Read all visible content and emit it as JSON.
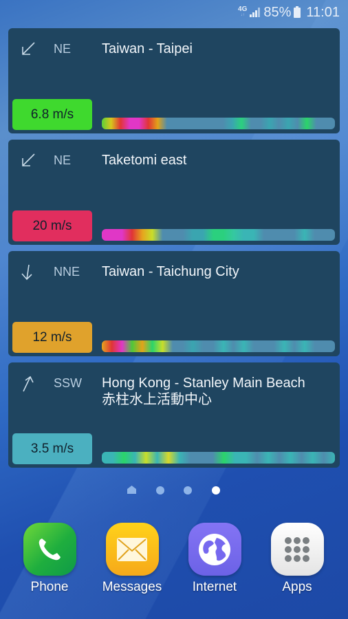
{
  "statusbar": {
    "network": "4G",
    "signal_icon": "signal-bars-icon",
    "battery_percent": "85%",
    "battery_icon": "battery-icon",
    "time": "11:01"
  },
  "widgets": [
    {
      "direction": "NE",
      "arrow_icon": "arrow-down-left-icon",
      "location": "Taiwan - Taipei",
      "subtitle": "",
      "speed": "6.8 m/s",
      "speed_color": "#3fd92e",
      "forecast_colors": [
        "#5cd03a",
        "#d6c81d",
        "#e03535",
        "#e037c6",
        "#e037c6",
        "#e03535",
        "#e3a319",
        "#4f8cae",
        "#4f8cae",
        "#4f8cae",
        "#4f8cae",
        "#4f8cae",
        "#4f8cae",
        "#4f8cae",
        "#3aa5b0",
        "#2bd07e",
        "#4f8cae",
        "#4f8cae",
        "#3aa5b0",
        "#4f8cae",
        "#3aa5b0",
        "#4f8cae",
        "#2bd46a",
        "#4f8cae",
        "#4f8cae",
        "#4f8cae"
      ]
    },
    {
      "direction": "NE",
      "arrow_icon": "arrow-down-left-icon",
      "location": "Taketomi east",
      "subtitle": "",
      "speed": "20 m/s",
      "speed_color": "#e12e5e",
      "forecast_colors": [
        "#e037c6",
        "#e037c6",
        "#e037c6",
        "#e03535",
        "#e6a41e",
        "#c8de2a",
        "#4f8cae",
        "#4f8cae",
        "#4f8cae",
        "#3aa5b0",
        "#3aa5b0",
        "#2bd07e",
        "#2bd07e",
        "#35c8a0",
        "#3ab5b5",
        "#3ab5b5",
        "#4f8cae",
        "#4f8cae",
        "#4f8cae",
        "#4f8cae",
        "#3ab5b5",
        "#4f8cae",
        "#4f8cae",
        "#4f8cae"
      ]
    },
    {
      "direction": "NNE",
      "arrow_icon": "arrow-down-icon",
      "location": "Taiwan - Taichung City",
      "subtitle": "",
      "speed": "12 m/s",
      "speed_color": "#e0a22c",
      "forecast_colors": [
        "#e6a41e",
        "#e03535",
        "#e037c6",
        "#4ec83a",
        "#e3a319",
        "#2bd46a",
        "#c8de2a",
        "#4f8cae",
        "#4f8cae",
        "#3aa5b0",
        "#4f8cae",
        "#4f8cae",
        "#3ab5b5",
        "#4f8cae",
        "#3ab5b5",
        "#4f8cae",
        "#4f8cae",
        "#4f8cae",
        "#3ab5b5",
        "#4f8cae",
        "#3ab5b5",
        "#4f8cae",
        "#4f8cae",
        "#4f8cae"
      ]
    },
    {
      "direction": "SSW",
      "arrow_icon": "arrow-up-right-icon",
      "location": "Hong Kong - Stanley Main Beach",
      "subtitle": "赤柱水上活動中心",
      "speed": "3.5 m/s",
      "speed_color": "#4bb0c0",
      "forecast_colors": [
        "#3ab5b5",
        "#3ab5b5",
        "#2bd46a",
        "#3ab5b5",
        "#c8de2a",
        "#3ab5b5",
        "#d8d82a",
        "#3ab5b5",
        "#4f8cae",
        "#4f8cae",
        "#4f8cae",
        "#2bd46a",
        "#3ab5b5",
        "#3ab5b5",
        "#4f8cae",
        "#3ab5b5",
        "#4f8cae",
        "#3ab5b5",
        "#4f8cae",
        "#3ab5b5",
        "#4f8cae",
        "#3ab5b5"
      ]
    }
  ],
  "page_indicator": {
    "pages": 4,
    "active_index": 3,
    "first_is_home": true
  },
  "dock": [
    {
      "label": "Phone",
      "icon": "phone-icon",
      "color": "#2fb74a"
    },
    {
      "label": "Messages",
      "icon": "envelope-icon",
      "color": "#f7b21a"
    },
    {
      "label": "Internet",
      "icon": "globe-icon",
      "color": "#7c6ef0"
    },
    {
      "label": "Apps",
      "icon": "apps-grid-icon",
      "color": "#f2f2f2"
    }
  ]
}
